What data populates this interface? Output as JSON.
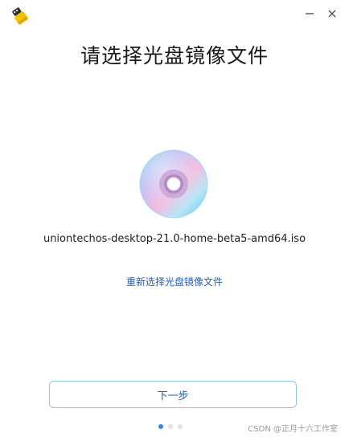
{
  "window": {
    "minimize_symbol": "—",
    "close_symbol": "×",
    "logo_icon": "usb-drive-icon"
  },
  "main": {
    "title": "请选择光盘镜像文件",
    "disc_icon": "disc-icon",
    "file_name": "uniontechos-desktop-21.0-home-beta5-amd64.iso",
    "reselect_label": "重新选择光盘镜像文件"
  },
  "footer": {
    "next_label": "下一步",
    "pagination": {
      "current": 1,
      "total": 3
    },
    "watermark": "CSDN @正月十六工作室"
  },
  "colors": {
    "link": "#1f5fbf",
    "button_border": "#8fc3ee",
    "active_dot": "#2a8ee8"
  }
}
